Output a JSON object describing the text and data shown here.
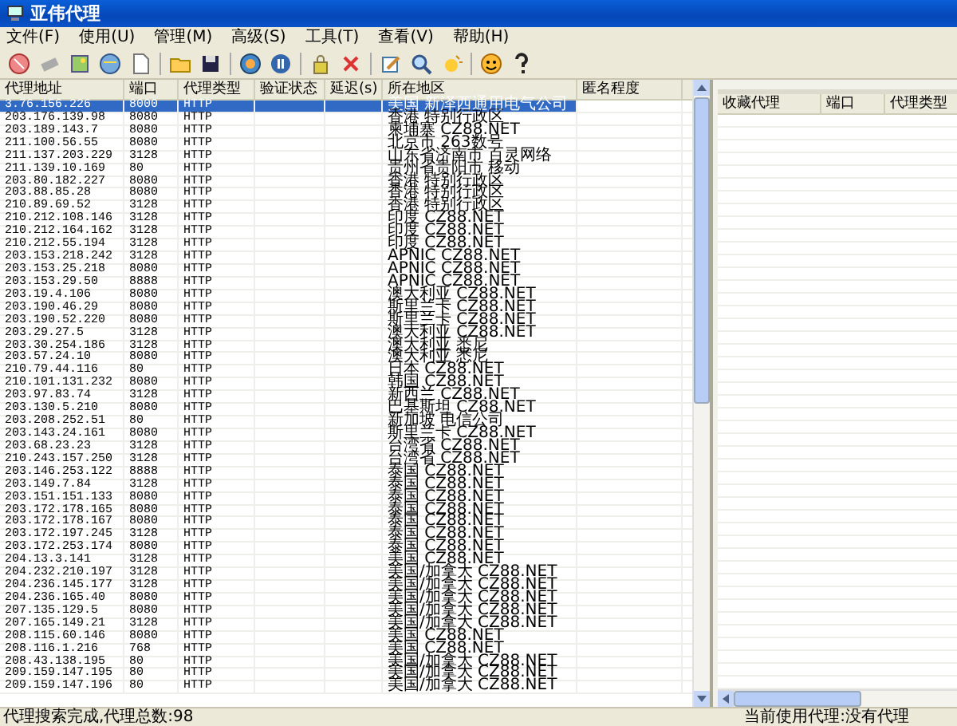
{
  "window": {
    "title": "亚伟代理"
  },
  "menu": [
    "文件(F)",
    "使用(U)",
    "管理(M)",
    "高级(S)",
    "工具(T)",
    "查看(V)",
    "帮助(H)"
  ],
  "table": {
    "columns": [
      "代理地址",
      "端口",
      "代理类型",
      "验证状态",
      "延迟(s)",
      "所在地区",
      "匿名程度"
    ],
    "rows": [
      {
        "address": "3.76.156.226",
        "port": "8000",
        "type": "HTTP",
        "region": "美国 新泽西通用电气公司",
        "selected": true
      },
      {
        "address": "203.176.139.98",
        "port": "8080",
        "type": "HTTP",
        "region": "香港 特别行政区",
        "selected": false
      },
      {
        "address": "203.189.143.7",
        "port": "8080",
        "type": "HTTP",
        "region": "柬埔寨  CZ88.NET",
        "selected": false
      },
      {
        "address": "211.100.56.55",
        "port": "8080",
        "type": "HTTP",
        "region": "北京市 263数号",
        "selected": false
      },
      {
        "address": "211.137.203.229",
        "port": "3128",
        "type": "HTTP",
        "region": "山东省济南市 百灵网络",
        "selected": false
      },
      {
        "address": "211.139.10.169",
        "port": "80",
        "type": "HTTP",
        "region": "贵州省贵阳市 移动",
        "selected": false
      },
      {
        "address": "203.80.182.227",
        "port": "8080",
        "type": "HTTP",
        "region": "香港 特别行政区",
        "selected": false
      },
      {
        "address": "203.88.85.28",
        "port": "8080",
        "type": "HTTP",
        "region": "香港 特别行政区",
        "selected": false
      },
      {
        "address": "210.89.69.52",
        "port": "3128",
        "type": "HTTP",
        "region": "香港 特别行政区",
        "selected": false
      },
      {
        "address": "210.212.108.146",
        "port": "3128",
        "type": "HTTP",
        "region": "印度  CZ88.NET",
        "selected": false
      },
      {
        "address": "210.212.164.162",
        "port": "3128",
        "type": "HTTP",
        "region": "印度  CZ88.NET",
        "selected": false
      },
      {
        "address": "210.212.55.194",
        "port": "3128",
        "type": "HTTP",
        "region": "印度  CZ88.NET",
        "selected": false
      },
      {
        "address": "203.153.218.242",
        "port": "3128",
        "type": "HTTP",
        "region": "APNIC  CZ88.NET",
        "selected": false
      },
      {
        "address": "203.153.25.218",
        "port": "8080",
        "type": "HTTP",
        "region": "APNIC  CZ88.NET",
        "selected": false
      },
      {
        "address": "203.153.29.50",
        "port": "8888",
        "type": "HTTP",
        "region": "APNIC  CZ88.NET",
        "selected": false
      },
      {
        "address": "203.19.4.106",
        "port": "8080",
        "type": "HTTP",
        "region": "澳大利亚  CZ88.NET",
        "selected": false
      },
      {
        "address": "203.190.46.29",
        "port": "8080",
        "type": "HTTP",
        "region": "斯里兰卡  CZ88.NET",
        "selected": false
      },
      {
        "address": "203.190.52.220",
        "port": "8080",
        "type": "HTTP",
        "region": "斯里兰卡  CZ88.NET",
        "selected": false
      },
      {
        "address": "203.29.27.5",
        "port": "3128",
        "type": "HTTP",
        "region": "澳大利亚  CZ88.NET",
        "selected": false
      },
      {
        "address": "203.30.254.186",
        "port": "3128",
        "type": "HTTP",
        "region": "澳大利亚 悉尼",
        "selected": false
      },
      {
        "address": "203.57.24.10",
        "port": "8080",
        "type": "HTTP",
        "region": "澳大利亚 悉尼",
        "selected": false
      },
      {
        "address": "210.79.44.116",
        "port": "80",
        "type": "HTTP",
        "region": "日本  CZ88.NET",
        "selected": false
      },
      {
        "address": "210.101.131.232",
        "port": "8080",
        "type": "HTTP",
        "region": "韩国  CZ88.NET",
        "selected": false
      },
      {
        "address": "203.97.83.74",
        "port": "3128",
        "type": "HTTP",
        "region": "新西兰  CZ88.NET",
        "selected": false
      },
      {
        "address": "203.130.5.210",
        "port": "8080",
        "type": "HTTP",
        "region": "巴基斯坦  CZ88.NET",
        "selected": false
      },
      {
        "address": "203.208.252.51",
        "port": "80",
        "type": "HTTP",
        "region": "新加坡 电信公司",
        "selected": false
      },
      {
        "address": "203.143.24.161",
        "port": "8080",
        "type": "HTTP",
        "region": "斯里兰卡  CZ88.NET",
        "selected": false
      },
      {
        "address": "203.68.23.23",
        "port": "3128",
        "type": "HTTP",
        "region": "台湾省  CZ88.NET",
        "selected": false
      },
      {
        "address": "210.243.157.250",
        "port": "3128",
        "type": "HTTP",
        "region": "台湾省  CZ88.NET",
        "selected": false
      },
      {
        "address": "203.146.253.122",
        "port": "8888",
        "type": "HTTP",
        "region": "泰国  CZ88.NET",
        "selected": false
      },
      {
        "address": "203.149.7.84",
        "port": "3128",
        "type": "HTTP",
        "region": "泰国  CZ88.NET",
        "selected": false
      },
      {
        "address": "203.151.151.133",
        "port": "8080",
        "type": "HTTP",
        "region": "泰国  CZ88.NET",
        "selected": false
      },
      {
        "address": "203.172.178.165",
        "port": "8080",
        "type": "HTTP",
        "region": "泰国  CZ88.NET",
        "selected": false
      },
      {
        "address": "203.172.178.167",
        "port": "8080",
        "type": "HTTP",
        "region": "泰国  CZ88.NET",
        "selected": false
      },
      {
        "address": "203.172.197.245",
        "port": "3128",
        "type": "HTTP",
        "region": "泰国  CZ88.NET",
        "selected": false
      },
      {
        "address": "203.172.253.174",
        "port": "8080",
        "type": "HTTP",
        "region": "泰国  CZ88.NET",
        "selected": false
      },
      {
        "address": "204.13.3.141",
        "port": "3128",
        "type": "HTTP",
        "region": "美国  CZ88.NET",
        "selected": false
      },
      {
        "address": "204.232.210.197",
        "port": "3128",
        "type": "HTTP",
        "region": "美国/加拿大  CZ88.NET",
        "selected": false
      },
      {
        "address": "204.236.145.177",
        "port": "3128",
        "type": "HTTP",
        "region": "美国/加拿大  CZ88.NET",
        "selected": false
      },
      {
        "address": "204.236.165.40",
        "port": "8080",
        "type": "HTTP",
        "region": "美国/加拿大  CZ88.NET",
        "selected": false
      },
      {
        "address": "207.135.129.5",
        "port": "8080",
        "type": "HTTP",
        "region": "美国/加拿大  CZ88.NET",
        "selected": false
      },
      {
        "address": "207.165.149.21",
        "port": "3128",
        "type": "HTTP",
        "region": "美国/加拿大  CZ88.NET",
        "selected": false
      },
      {
        "address": "208.115.60.146",
        "port": "8080",
        "type": "HTTP",
        "region": "美国  CZ88.NET",
        "selected": false
      },
      {
        "address": "208.116.1.216",
        "port": "768",
        "type": "HTTP",
        "region": "美国  CZ88.NET",
        "selected": false
      },
      {
        "address": "208.43.138.195",
        "port": "80",
        "type": "HTTP",
        "region": "美国/加拿大  CZ88.NET",
        "selected": false
      },
      {
        "address": "209.159.147.195",
        "port": "80",
        "type": "HTTP",
        "region": "美国/加拿大  CZ88.NET",
        "selected": false
      },
      {
        "address": "209.159.147.196",
        "port": "80",
        "type": "HTTP",
        "region": "美国/加拿大  CZ88.NET",
        "selected": false
      }
    ]
  },
  "favorites": {
    "columns": [
      "收藏代理",
      "端口",
      "代理类型"
    ]
  },
  "status_bar": {
    "left": "代理搜索完成,代理总数:98",
    "right": "当前使用代理:没有代理"
  }
}
